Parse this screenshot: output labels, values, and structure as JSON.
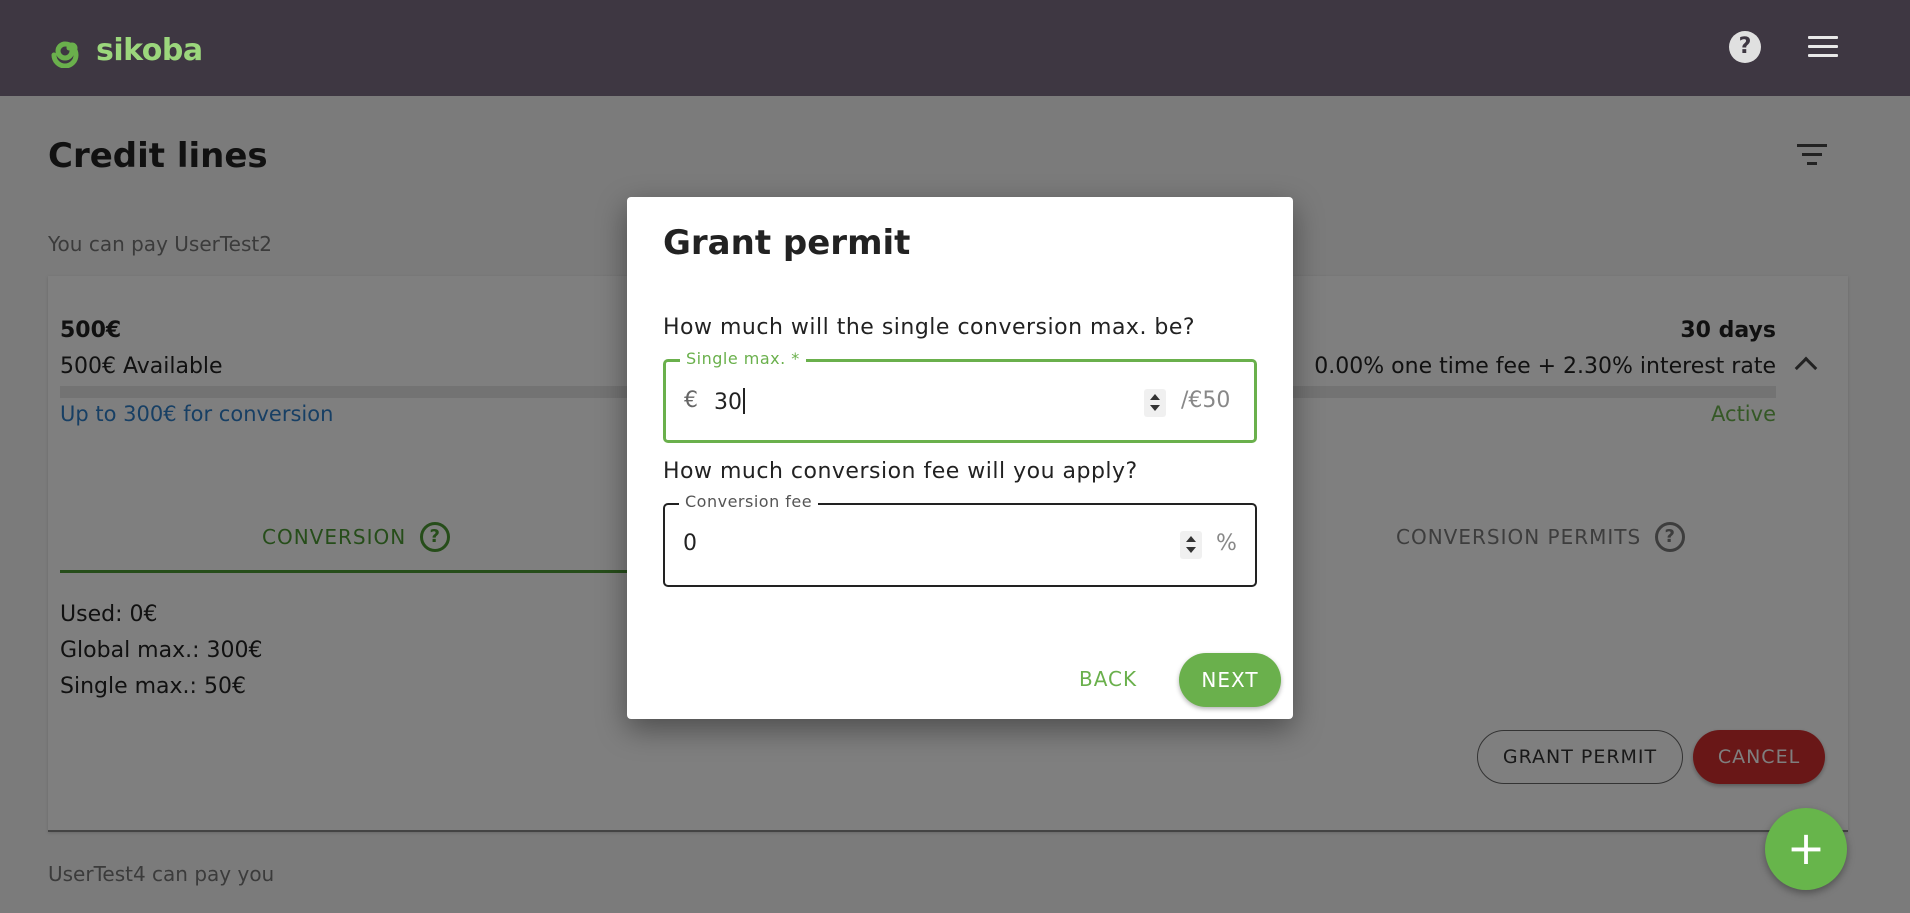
{
  "header": {
    "brand": "sikoba",
    "help_glyph": "?",
    "icons": {
      "logo": "spiral-logo-icon",
      "help": "help-icon",
      "menu": "hamburger-menu-icon"
    }
  },
  "page": {
    "title": "Credit lines",
    "sections": {
      "you_can_pay": "You can pay UserTest2",
      "can_pay_you": "UserTest4 can pay you"
    }
  },
  "credit_line": {
    "amount": "500€",
    "available": "500€ Available",
    "conversion_limit": "Up to 300€ for conversion",
    "duration": "30 days",
    "fees": "0.00% one time fee + 2.30% interest rate",
    "status": "Active",
    "tabs": [
      {
        "label": "CONVERSION"
      },
      {
        "label": "CONVERSION PERMITS"
      }
    ],
    "stats": {
      "used": "Used: 0€",
      "global_max": "Global max.: 300€",
      "single_max": "Single max.: 50€"
    },
    "actions": {
      "grant_permit": "GRANT PERMIT",
      "cancel": "CANCEL"
    }
  },
  "fab_glyph": "+",
  "dialog": {
    "title": "Grant permit",
    "question_single_max": "How much will the single conversion max. be?",
    "single_max_field": {
      "legend": "Single max. *",
      "prefix": "€",
      "value": "30",
      "suffix": "/€50"
    },
    "question_fee": "How much conversion fee will you apply?",
    "fee_field": {
      "legend": "Conversion fee",
      "value": "0",
      "suffix": "%"
    },
    "back_label": "BACK",
    "next_label": "NEXT"
  },
  "colors": {
    "appbar": "#3e3742",
    "accent_green": "#6ab04c",
    "link_blue": "#2f7fc8",
    "cancel_red": "#d32f2f"
  }
}
